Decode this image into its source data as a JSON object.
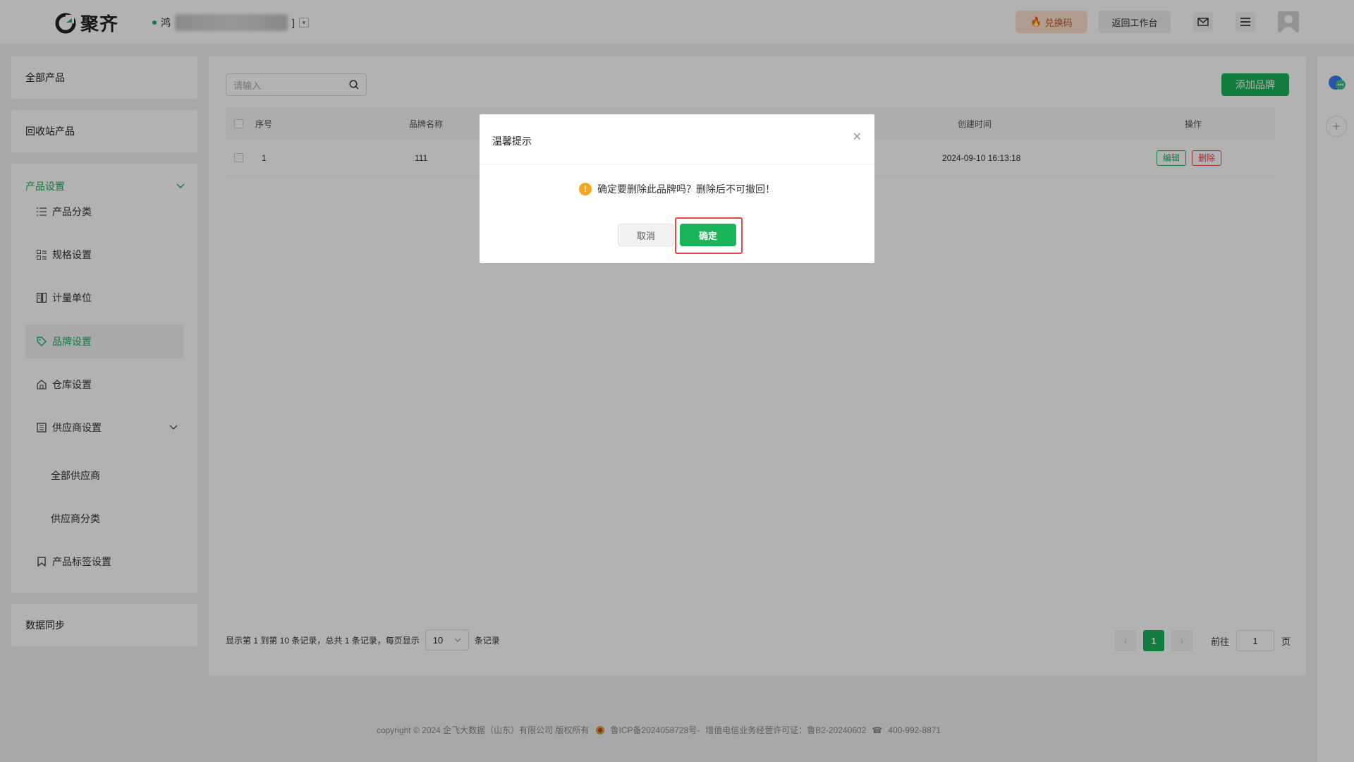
{
  "header": {
    "brand": "聚齐",
    "tenant_prefix": "鸿",
    "tenant_suffix": "]",
    "exchange_label": "兑换码",
    "back_label": "返回工作台"
  },
  "sidebar": {
    "all_products": "全部产品",
    "recycle_products": "回收站产品",
    "group_title": "产品设置",
    "items": [
      {
        "label": "产品分类"
      },
      {
        "label": "规格设置"
      },
      {
        "label": "计量单位"
      },
      {
        "label": "品牌设置"
      },
      {
        "label": "仓库设置"
      },
      {
        "label": "供应商设置"
      },
      {
        "label": "全部供应商"
      },
      {
        "label": "供应商分类"
      },
      {
        "label": "产品标签设置"
      }
    ],
    "data_sync": "数据同步"
  },
  "main": {
    "search_placeholder": "请输入",
    "add_button": "添加品牌",
    "columns": {
      "index": "序号",
      "name": "品牌名称",
      "created": "创建时间",
      "actions": "操作"
    },
    "rows": [
      {
        "index": "1",
        "name": "111",
        "created": "2024-09-10 16:13:18",
        "edit": "编辑",
        "delete": "删除"
      }
    ],
    "pager": {
      "info": "显示第 1 到第 10 条记录，总共 1 条记录，每页显示",
      "page_size": "10",
      "records_suffix": "条记录",
      "current": "1",
      "goto_label": "前往",
      "goto_value": "1",
      "page_suffix": "页"
    }
  },
  "footer": {
    "copyright": "copyright © 2024 企飞大数据（山东）有限公司 版权所有",
    "icp": "鲁ICP备2024058728号-",
    "license": "增值电信业务经营许可证：鲁B2-20240602",
    "phone": "400-992-8871"
  },
  "dialog": {
    "title": "温馨提示",
    "message": "确定要删除此品牌吗？删除后不可撤回！",
    "cancel": "取消",
    "confirm": "确定"
  },
  "colors": {
    "accent": "#17b45a",
    "danger": "#e54545",
    "warning": "#f5a623"
  }
}
